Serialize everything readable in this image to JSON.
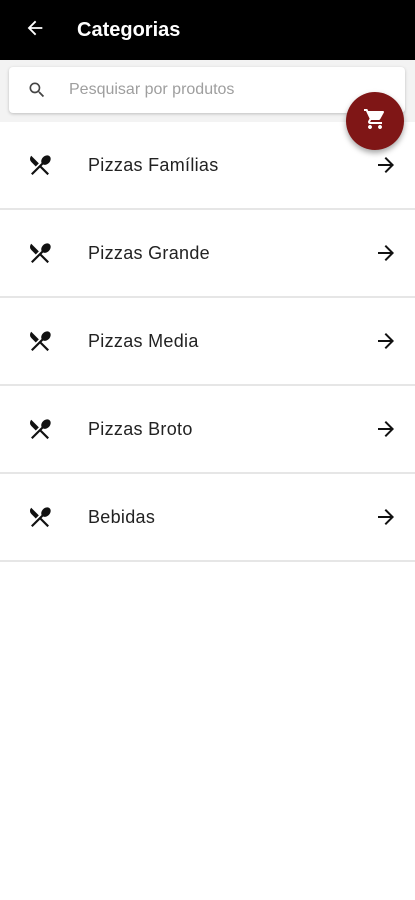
{
  "header": {
    "title": "Categorias",
    "background_color": "#000000",
    "back_icon": "arrow-left-icon"
  },
  "search": {
    "placeholder": "Pesquisar por produtos",
    "value": "",
    "icon": "search-icon"
  },
  "cart_fab": {
    "icon": "shopping-cart-icon",
    "color": "#7f1616"
  },
  "categories": [
    {
      "label": "Pizzas Famílias",
      "icon": "fork-spoon-icon",
      "action_icon": "arrow-right-icon"
    },
    {
      "label": "Pizzas Grande",
      "icon": "fork-spoon-icon",
      "action_icon": "arrow-right-icon"
    },
    {
      "label": "Pizzas Media",
      "icon": "fork-spoon-icon",
      "action_icon": "arrow-right-icon"
    },
    {
      "label": "Pizzas Broto",
      "icon": "fork-spoon-icon",
      "action_icon": "arrow-right-icon"
    },
    {
      "label": "Bebidas",
      "icon": "fork-spoon-icon",
      "action_icon": "arrow-right-icon"
    }
  ]
}
